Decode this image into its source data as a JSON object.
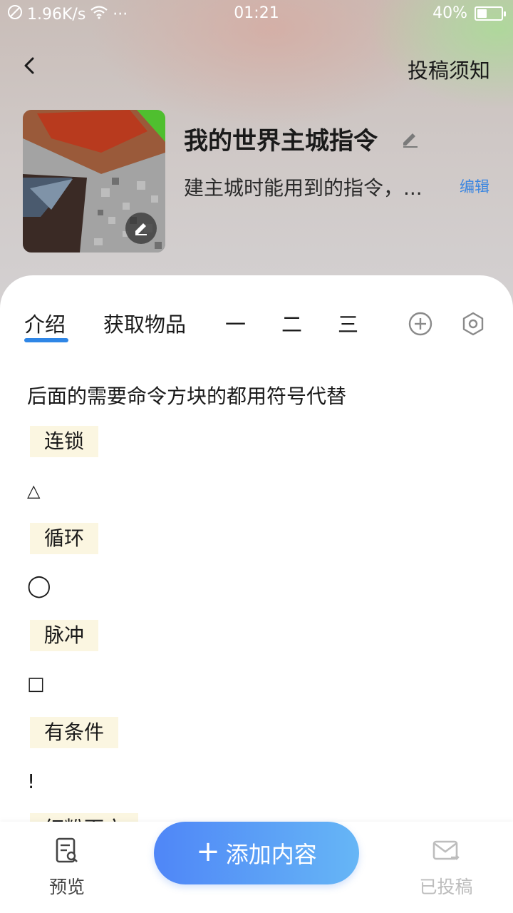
{
  "status_bar": {
    "speed": "1.96K/s",
    "dots": "···",
    "time": "01:21",
    "battery_percent": "40%",
    "battery_level": 0.4
  },
  "header": {
    "notice_label": "投稿须知"
  },
  "album": {
    "title": "我的世界主城指令",
    "description": "建主城时能用到的指令，...",
    "edit_label": "编辑"
  },
  "tabs": [
    {
      "label": "介绍"
    },
    {
      "label": "获取物品"
    },
    {
      "label": "一"
    },
    {
      "label": "二"
    },
    {
      "label": "三"
    }
  ],
  "content": {
    "intro": "后面的需要命令方块的都用符号代替",
    "items": [
      {
        "chip": "连锁",
        "symbol": "△"
      },
      {
        "chip": "循环",
        "symbol": "◯"
      },
      {
        "chip": "脉冲",
        "symbol": "□"
      },
      {
        "chip": "有条件",
        "symbol": "!"
      }
    ],
    "partial_chip": "红粉面方"
  },
  "bottom_nav": {
    "preview_label": "预览",
    "add_label": "添加内容",
    "add_plus": "+",
    "submitted_label": "已投稿"
  },
  "colors": {
    "accent": "#2f86e6",
    "chip_bg": "#fbf6e1",
    "button_start": "#4f86f7",
    "button_end": "#66b6f6",
    "muted": "#bdbdbd"
  }
}
